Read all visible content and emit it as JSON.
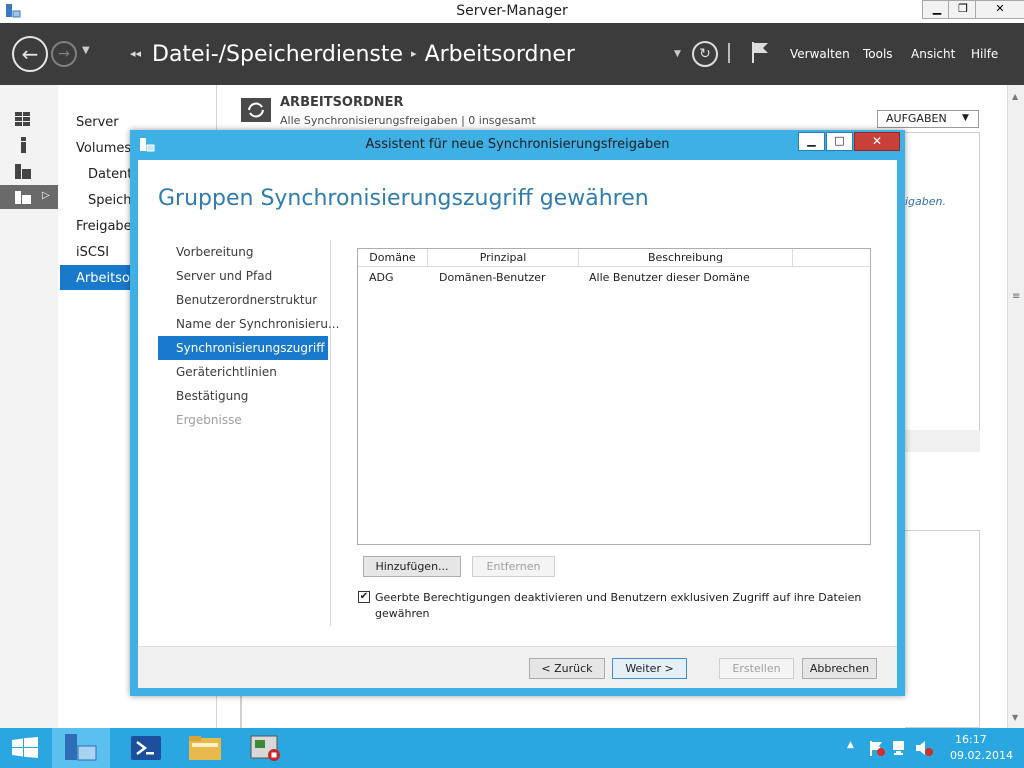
{
  "window": {
    "title": "Server-Manager",
    "min": "▁",
    "restore": "❐",
    "close": "✕"
  },
  "nav": {
    "breadcrumb": [
      "Datei-/Speicherdienste",
      "Arbeitsordner"
    ],
    "sep": "▸",
    "menu": [
      "Verwalten",
      "Tools",
      "Ansicht",
      "Hilfe"
    ]
  },
  "leftnav": {
    "items": [
      "Server",
      "Volumes",
      "Datentr",
      "Speich",
      "Freigaben",
      "iSCSI",
      "Arbeitsor"
    ]
  },
  "main": {
    "section_title": "ARBEITSORDNER",
    "section_subtitle": "Alle Synchronisierungsfreigaben | 0 insgesamt",
    "tasks_button": "AUFGABEN",
    "tasks_arrow": "▼",
    "side_text": "igaben."
  },
  "dialog": {
    "title": "Assistent für neue Synchronisierungsfreigaben",
    "heading": "Gruppen Synchronisierungszugriff gewähren",
    "steps": [
      "Vorbereitung",
      "Server und Pfad",
      "Benutzerordnerstruktur",
      "Name der Synchronisieru...",
      "Synchronisierungszugriff",
      "Geräterichtlinien",
      "Bestätigung",
      "Ergebnisse"
    ],
    "selected_step": "Synchronisierungszugriff",
    "table": {
      "headers": [
        "Domäne",
        "Prinzipal",
        "Beschreibung"
      ],
      "rows": [
        [
          "ADG",
          "Domänen-Benutzer",
          "Alle Benutzer dieser Domäne"
        ]
      ]
    },
    "add_button": "Hinzufügen...",
    "remove_button": "Entfernen",
    "checkbox_checked": true,
    "checkbox_line1": "Geerbte Berechtigungen deaktivieren und Benutzern exklusiven Zugriff auf ihre Dateien",
    "checkbox_line2": "gewähren",
    "back_button": "< Zurück",
    "next_button": "Weiter >",
    "create_button": "Erstellen",
    "cancel_button": "Abbrechen"
  },
  "taskbar": {
    "time": "16:17",
    "date": "09.02.2014",
    "tray_arrow": "▲"
  },
  "colors": {
    "accent": "#1979ca",
    "dialog_frame": "#3fb0e6",
    "taskbar": "#2aa6e1",
    "header": "#3c3c3c"
  }
}
